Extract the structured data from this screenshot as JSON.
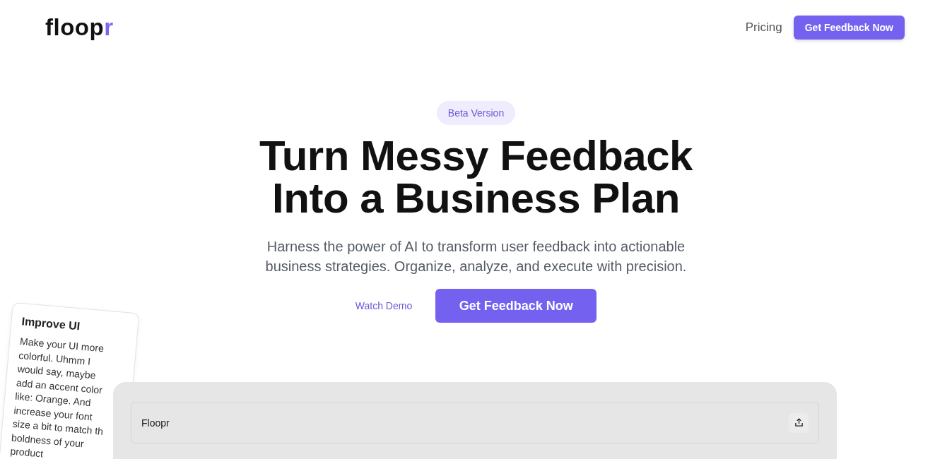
{
  "header": {
    "logo": [
      {
        "text": "floop",
        "accent": false
      },
      {
        "text": "r",
        "accent": true
      }
    ],
    "nav": [
      {
        "label": "Pricing",
        "kind": "link"
      },
      {
        "label": "Get Feedback Now",
        "kind": "button"
      }
    ]
  },
  "hero": {
    "badge": "Beta Version",
    "title": [
      "Turn Messy Feedback",
      "Into a Business Plan"
    ],
    "subtitle": [
      "Harness the power of AI to transform user feedback into actionable",
      "business strategies. Organize, analyze, and execute with precision."
    ],
    "actions": [
      {
        "label": "Watch Demo",
        "kind": "link"
      },
      {
        "label": "Get Feedback Now",
        "kind": "button"
      }
    ]
  },
  "feedback_card": {
    "title": "Improve UI",
    "lines": [
      "Make your UI more",
      "colorful. Uhmm I",
      "would say, maybe",
      "add an accent color",
      "like: Orange. And",
      "increase your font",
      "size a bit to match th",
      "boldness of your",
      "product"
    ]
  },
  "preview": {
    "title": "Floopr"
  }
}
